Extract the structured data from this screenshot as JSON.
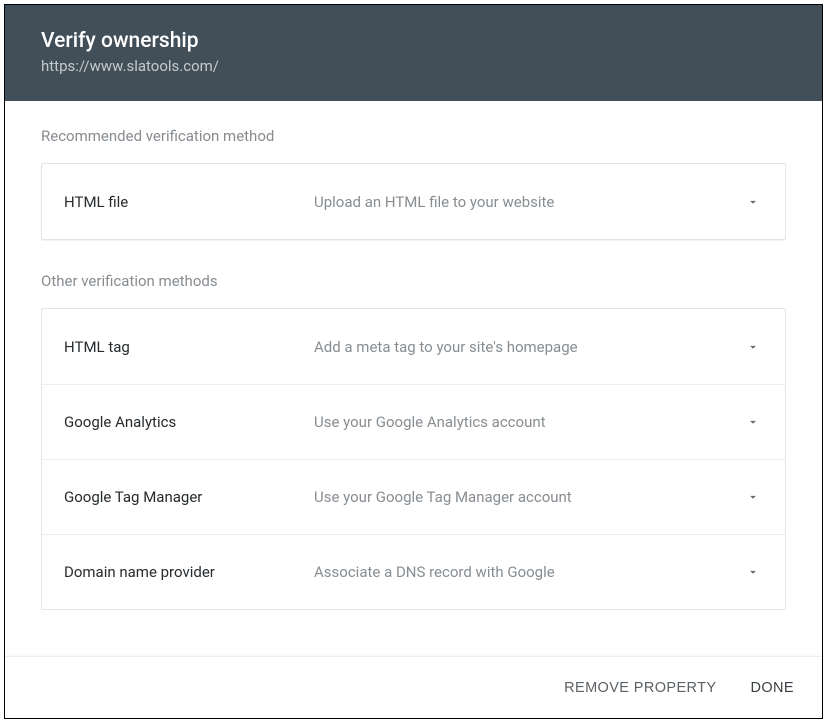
{
  "header": {
    "title": "Verify ownership",
    "subtitle": "https://www.slatools.com/"
  },
  "sections": {
    "recommended_label": "Recommended verification method",
    "other_label": "Other verification methods"
  },
  "recommended": {
    "title": "HTML file",
    "desc": "Upload an HTML file to your website"
  },
  "other": [
    {
      "title": "HTML tag",
      "desc": "Add a meta tag to your site's homepage"
    },
    {
      "title": "Google Analytics",
      "desc": "Use your Google Analytics account"
    },
    {
      "title": "Google Tag Manager",
      "desc": "Use your Google Tag Manager account"
    },
    {
      "title": "Domain name provider",
      "desc": "Associate a DNS record with Google"
    }
  ],
  "footer": {
    "remove": "REMOVE PROPERTY",
    "done": "DONE"
  }
}
